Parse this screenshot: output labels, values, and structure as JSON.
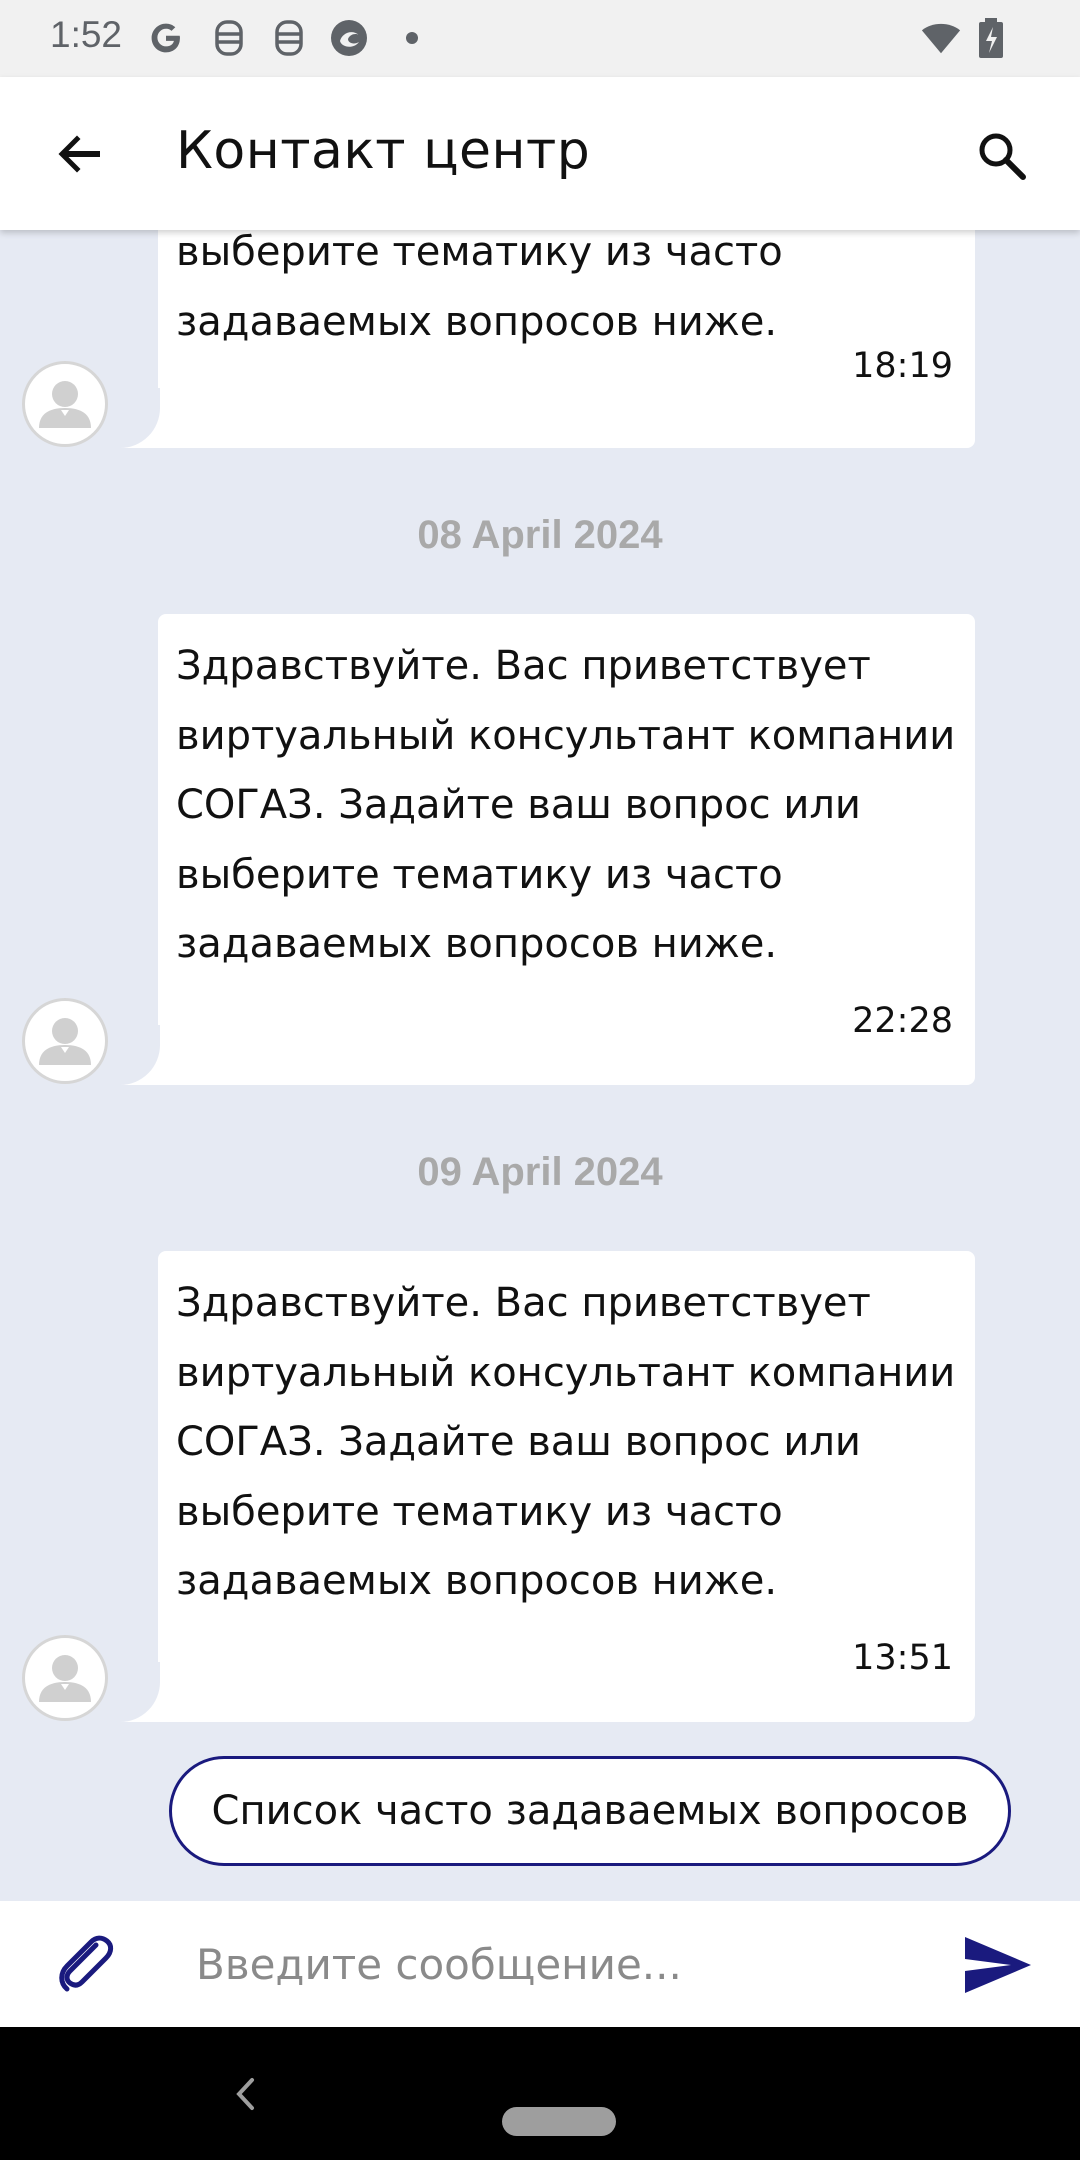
{
  "status_bar": {
    "time": "1:52",
    "icons": [
      "google-g-icon",
      "security-icon",
      "security-icon",
      "browser-icon",
      "notification-dot-icon",
      "wifi-icon",
      "battery-charging-icon"
    ]
  },
  "app_bar": {
    "title": "Контакт центр",
    "back_icon": "arrow-back-icon",
    "search_icon": "search-icon"
  },
  "messages": [
    {
      "text": "выберите тематику из часто\nзадаваемых вопросов ниже.",
      "time": "18:19"
    },
    {
      "date": "08 April 2024",
      "text": "Здравствуйте. Вас приветствует\nвиртуальный консультант компании\nСОГАЗ. Задайте ваш вопрос или\nвыберите тематику из часто\nзадаваемых вопросов ниже.",
      "time": "22:28"
    },
    {
      "date": "09 April 2024",
      "text": "Здравствуйте. Вас приветствует\nвиртуальный консультант компании\nСОГАЗ. Задайте ваш вопрос или\nвыберите тематику из часто\nзадаваемых вопросов ниже.",
      "time": "13:51"
    }
  ],
  "faq_button": {
    "label": "Список часто задаваемых вопросов"
  },
  "input_bar": {
    "placeholder": "Введите сообщение...",
    "value": "",
    "attach_icon": "paperclip-icon",
    "send_icon": "send-icon"
  },
  "colors": {
    "chat_background": "#e6eaf3",
    "accent": "#1a1a7e",
    "date_text": "#a9a9a9",
    "bubble": "#ffffff"
  }
}
